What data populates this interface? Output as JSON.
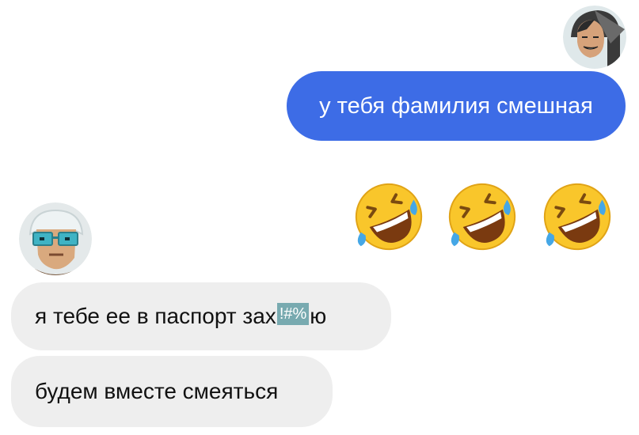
{
  "outgoing": {
    "text": "у тебя фамилия смешная",
    "bubble_color": "#3d6ce6"
  },
  "reaction": {
    "emoji": [
      "rolling-on-floor-laughing",
      "rolling-on-floor-laughing",
      "rolling-on-floor-laughing"
    ]
  },
  "incoming": {
    "line1_start": "я тебе ее в паспорт зах",
    "line1_censor": "!#%",
    "line1_end": "ю",
    "line2": "будем вместе смеяться",
    "bubble_color": "#eeeeee"
  },
  "avatars": {
    "sender": "woman-avatar",
    "receiver": "old-man-with-glasses-avatar"
  }
}
